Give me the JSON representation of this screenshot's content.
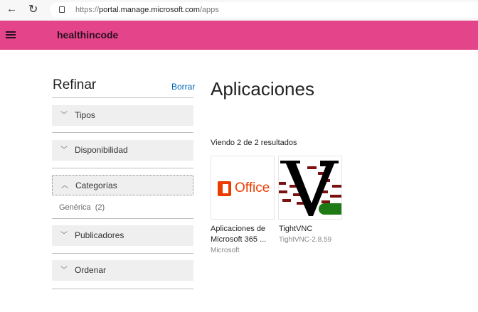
{
  "browser": {
    "url_prefix": "https://",
    "url_host": "portal.manage.microsoft.com",
    "url_path": "/apps"
  },
  "header": {
    "brand": "healthincode"
  },
  "sidebar": {
    "title": "Refinar",
    "clear": "Borrar",
    "sections": [
      {
        "label": "Tipos",
        "expanded": false
      },
      {
        "label": "Disponibilidad",
        "expanded": false
      },
      {
        "label": "Categorías",
        "expanded": true
      },
      {
        "label": "Publicadores",
        "expanded": false
      },
      {
        "label": "Ordenar",
        "expanded": false
      }
    ],
    "categories": [
      {
        "label": "Genérica",
        "count": "(2)"
      }
    ]
  },
  "main": {
    "title": "Aplicaciones",
    "results": "Viendo 2 de 2 resultados",
    "apps": [
      {
        "name_line1": "Aplicaciones de",
        "name_line2": "Microsoft 365 ...",
        "publisher": "Microsoft",
        "logo_text": "Office"
      },
      {
        "name_line1": "TightVNC",
        "version": "TightVNC-2.8.59"
      }
    ]
  },
  "colors": {
    "header": "#e3448a",
    "link": "#0067b8",
    "office": "#eb3c00"
  }
}
